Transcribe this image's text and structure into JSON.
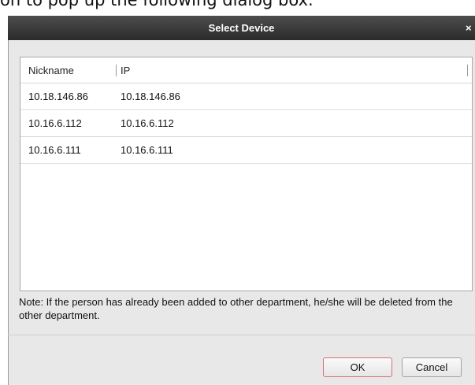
{
  "background_text": "on to pop up the following dialog box.",
  "dialog": {
    "title": "Select Device",
    "close_symbol": "×",
    "columns": {
      "nickname": "Nickname",
      "ip": "IP"
    },
    "rows": [
      {
        "nickname": "10.18.146.86",
        "ip": "10.18.146.86"
      },
      {
        "nickname": "10.16.6.112",
        "ip": "10.16.6.112"
      },
      {
        "nickname": "10.16.6.111",
        "ip": "10.16.6.111"
      }
    ],
    "note": "Note: If the person has already been added to other department, he/she will be deleted from the other department.",
    "ok_label": "OK",
    "cancel_label": "Cancel"
  },
  "colors": {
    "titlebar": "#3a3a3a",
    "dialog_bg": "#e8e8e8",
    "ok_border": "#d96f6f"
  }
}
